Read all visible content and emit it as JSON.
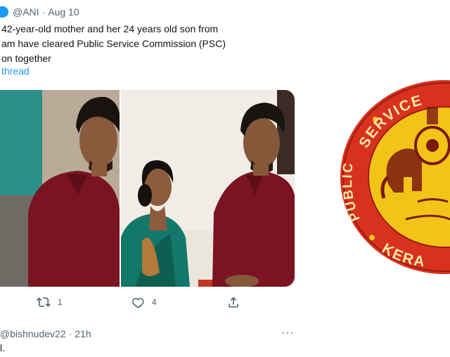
{
  "tweet": {
    "handle": "@ANI",
    "separator": "·",
    "date": "Aug 10",
    "text_lines": [
      "42-year-old mother and her 24 years old son from",
      "am have cleared Public Service Commission (PSC)",
      "on together"
    ],
    "show_thread": "thread",
    "actions": {
      "retweet_count": "1",
      "like_count": "4"
    }
  },
  "reply": {
    "handle": "@bishnudev22",
    "separator": "·",
    "time": "21h",
    "more": "···",
    "text": "l."
  },
  "emblem": {
    "text_top": "SERVICE",
    "text_left": "PUBLIC",
    "text_bottom": "KERA",
    "colors": {
      "outer": "#d8321e",
      "inner": "#f2c418",
      "ink": "#7a1a10"
    }
  },
  "colors": {
    "accent": "#1d9bf0",
    "muted": "#536471",
    "text": "#0f1419"
  },
  "icons": [
    "verified-badge",
    "retweet-icon",
    "like-icon",
    "share-icon",
    "more-icon"
  ]
}
